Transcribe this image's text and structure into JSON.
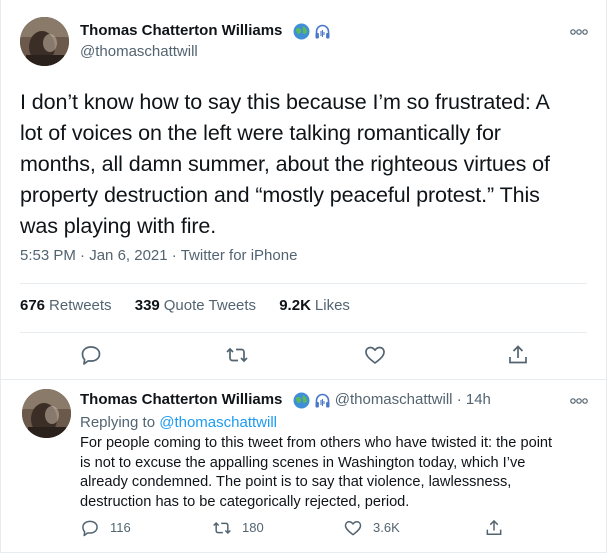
{
  "main_tweet": {
    "author_name": "Thomas Chatterton Williams",
    "handle": "@thomaschattwill",
    "text_lines": [
      "I don’t know how to say this because I’m so frustrated: A",
      "lot of voices on the left were talking romantically for",
      "months, all damn summer, about the righteous virtues of",
      "property destruction and “mostly peaceful protest.” This",
      "was playing with fire."
    ],
    "time": "5:53 PM",
    "date": "Jan 6, 2021",
    "source": "Twitter for iPhone",
    "separator": "·",
    "stats": {
      "retweets_count": "676",
      "retweets_label": "Retweets",
      "quote_count": "339",
      "quote_label": "Quote Tweets",
      "likes_count": "9.2K",
      "likes_label": "Likes"
    },
    "badges": [
      "globe-icon",
      "headphones-icon"
    ],
    "actions": [
      "reply-icon",
      "retweet-icon",
      "like-icon",
      "share-icon"
    ]
  },
  "reply_tweet": {
    "author_name": "Thomas Chatterton Williams",
    "handle": "@thomaschattwill",
    "separator": "·",
    "age": "14h",
    "replying_prefix": "Replying to",
    "replying_to": "@thomaschattwill",
    "text_lines": [
      "For people coming to this tweet from others who have twisted it: the point",
      "is not to excuse the appalling scenes in Washington today, which I’ve",
      "already condemned. The point is to say that violence, lawlessness,",
      "destruction has to be categorically rejected, period."
    ],
    "replies": "116",
    "retweets": "180",
    "likes": "3.6K"
  },
  "colors": {
    "text": "#0f1419",
    "secondary": "#536471",
    "link": "#1d9bf0",
    "divider": "#e6ecf0"
  }
}
